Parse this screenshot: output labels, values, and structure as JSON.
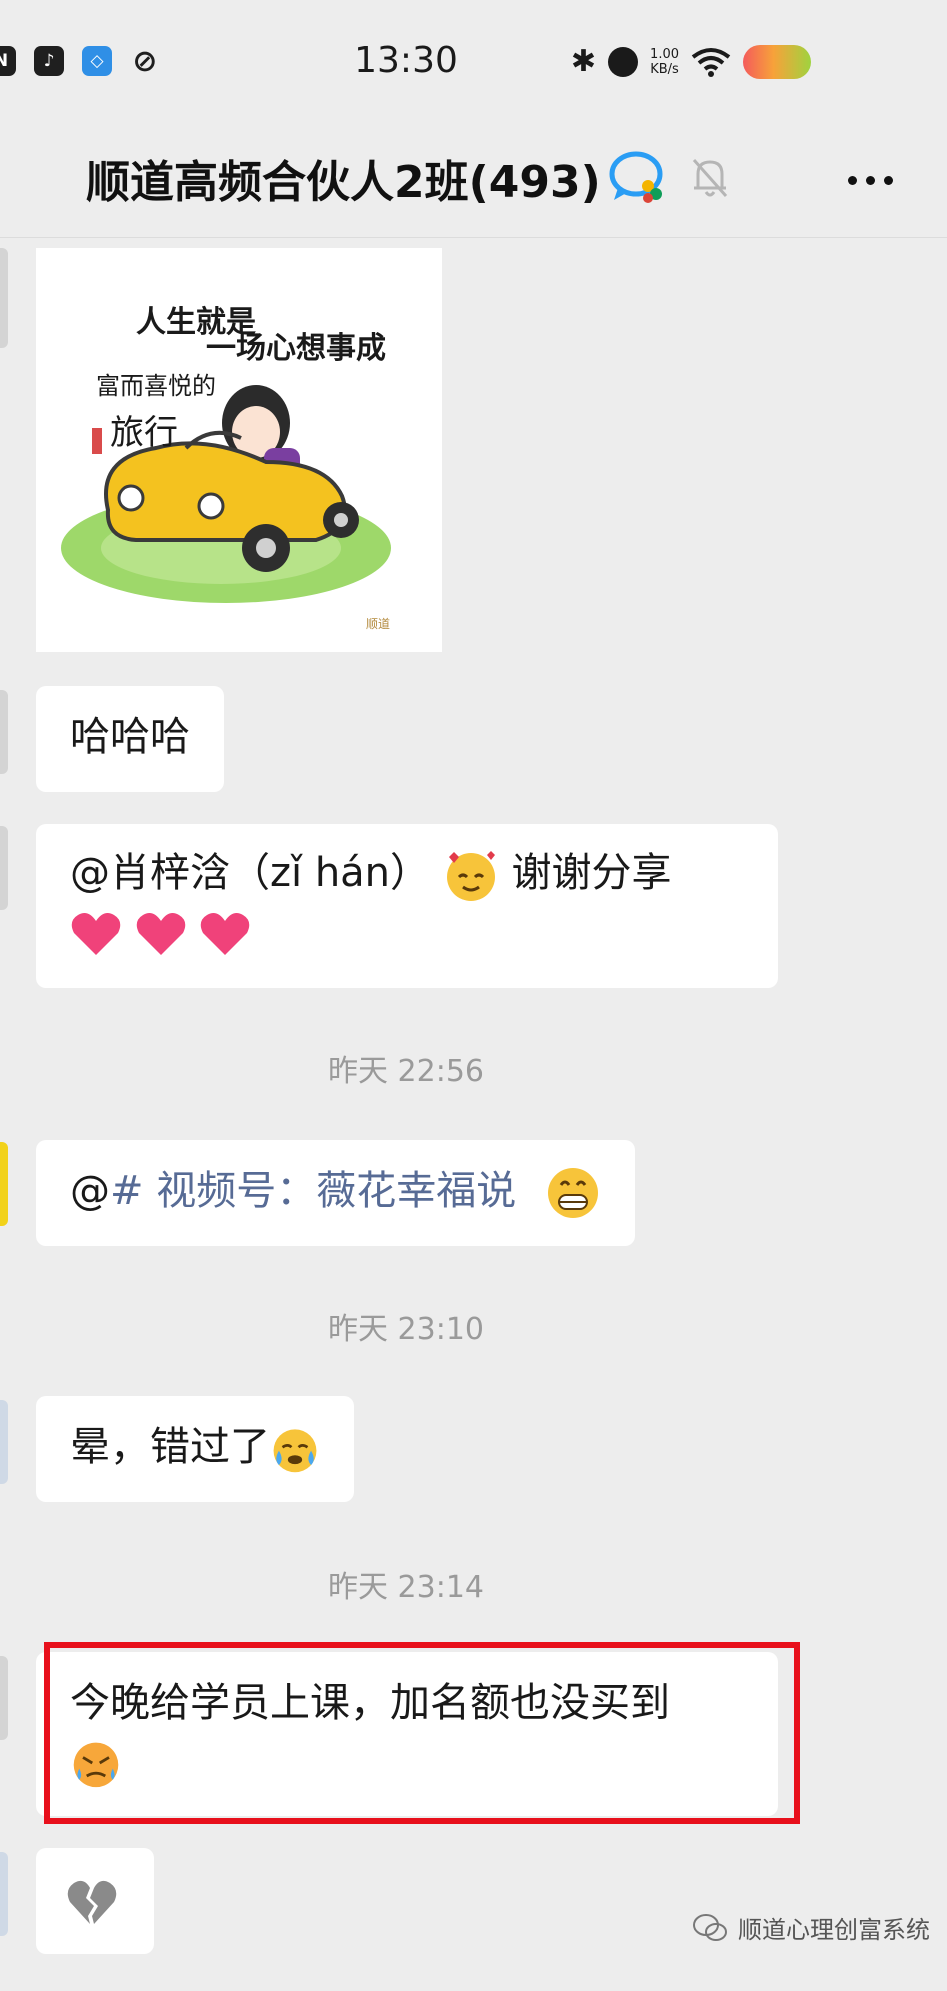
{
  "status_bar": {
    "time": "13:30",
    "speed_value": "1.00",
    "speed_unit": "KB/s",
    "left_icons": [
      "nfc-icon",
      "tiktok-icon",
      "app-icon",
      "link-icon"
    ],
    "right_icons": [
      "bluetooth-icon",
      "alarm-icon",
      "wifi-icon",
      "battery-icon"
    ]
  },
  "header": {
    "title": "顺道高频合伙人2班(493)"
  },
  "sticker": {
    "line1": "人生就是",
    "line2": "一场心想事成",
    "line3": "富而喜悦的",
    "line4": "旅行",
    "brand": "顺道"
  },
  "messages": [
    {
      "type": "text",
      "text": "哈哈哈"
    },
    {
      "type": "text",
      "text": "@肖梓浛（zǐ hán）",
      "suffix": "谢谢分享"
    },
    {
      "type": "time",
      "text": "昨天 22:56"
    },
    {
      "type": "text",
      "prefix": "@",
      "mention": "# 视频号：薇花幸福说"
    },
    {
      "type": "time",
      "text": "昨天 23:10"
    },
    {
      "type": "text",
      "text": "晕，错过了"
    },
    {
      "type": "time",
      "text": "昨天 23:14"
    },
    {
      "type": "text",
      "text": "今晚给学员上课，加名额也没买到"
    },
    {
      "type": "emoji",
      "text": "broken-heart"
    }
  ],
  "colors": {
    "background": "#ededed",
    "bubble": "#ffffff",
    "mention": "#576b95",
    "highlight": "#e8101c"
  },
  "watermark": "顺道心理创富系统"
}
